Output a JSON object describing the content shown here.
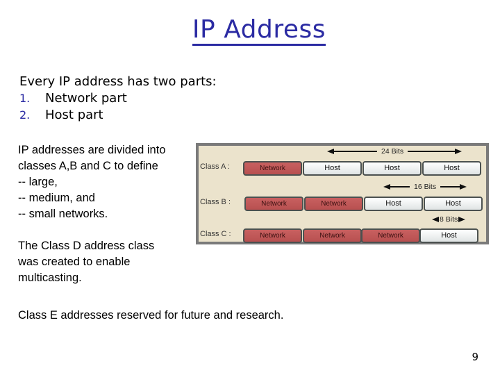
{
  "slide": {
    "title": "IP Address",
    "intro": {
      "heading": "Every IP address has two parts:",
      "items": [
        {
          "number": "1.",
          "text": "Network part"
        },
        {
          "number": "2.",
          "text": "Host part"
        }
      ]
    },
    "classes_paragraph": [
      "IP addresses are divided into",
      "classes A,B and C to define",
      "-- large,",
      "-- medium, and",
      "-- small networks."
    ],
    "class_d_paragraph": [
      "The Class D address class",
      "was created to enable",
      "multicasting."
    ],
    "class_e_paragraph": "Class E addresses reserved for future and research.",
    "page_number": "9"
  },
  "diagram": {
    "colors": {
      "network": "#c05858",
      "host": "#eef1f1",
      "background": "#ebe3cc",
      "border": "#7a7a7a"
    },
    "classes": [
      {
        "label": "Class A :",
        "bits_label": "24 Bits",
        "octets": [
          "Network",
          "Host",
          "Host",
          "Host"
        ]
      },
      {
        "label": "Class B :",
        "bits_label": "16 Bits",
        "octets": [
          "Network",
          "Network",
          "Host",
          "Host"
        ]
      },
      {
        "label": "Class C :",
        "bits_label": "8 Bits",
        "octets": [
          "Network",
          "Network",
          "Network",
          "Host"
        ]
      }
    ]
  }
}
